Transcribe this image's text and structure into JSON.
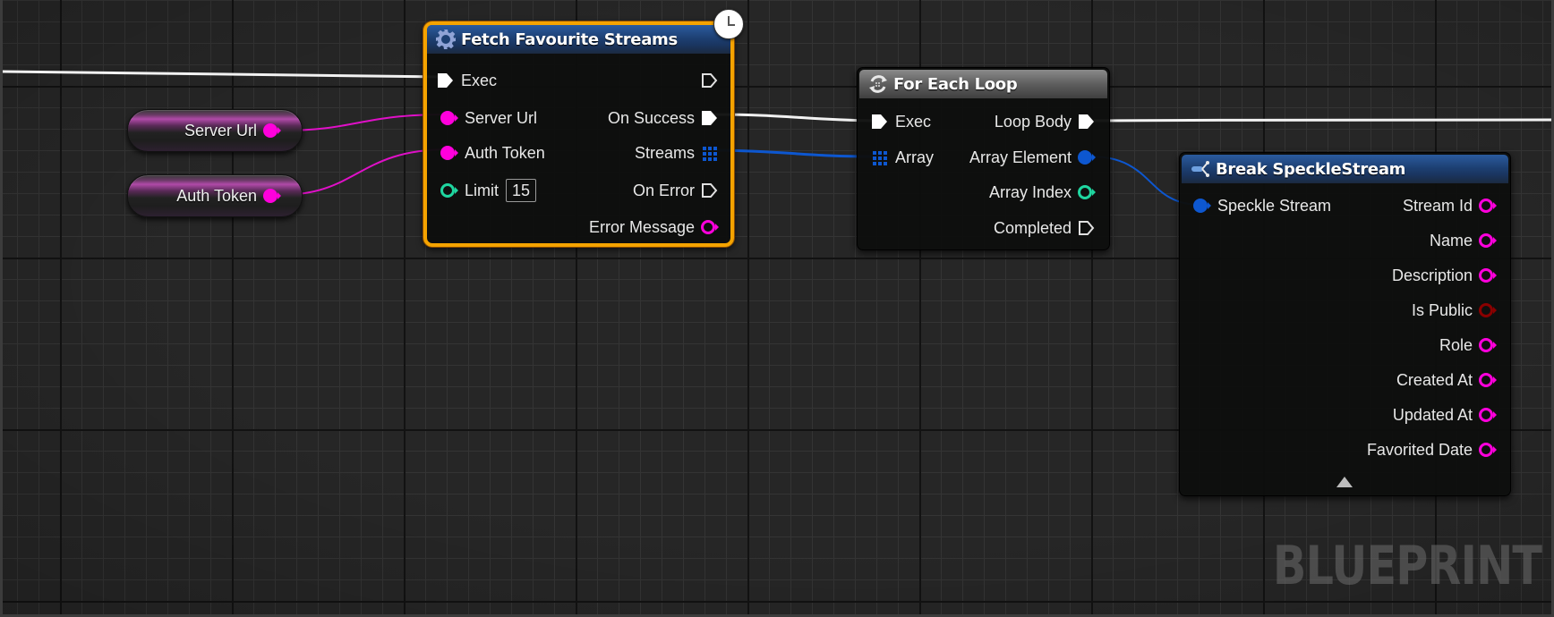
{
  "watermark": "BLUEPRINT",
  "colors": {
    "exec": "#ffffff",
    "string_pin": "#ff00dc",
    "struct_pin": "#0a5ed6",
    "int_pin": "#1fd6a0",
    "bool_pin": "#8a0000",
    "selected_border": "#f5a300"
  },
  "variables": [
    {
      "label": "Server Url",
      "type": "string"
    },
    {
      "label": "Auth Token",
      "type": "string"
    }
  ],
  "fetch_node": {
    "title": "Fetch Favourite Streams",
    "icon": "gear-icon",
    "badge": "clock-icon",
    "inputs": [
      {
        "label": "Exec",
        "type": "exec"
      },
      {
        "label": "Server Url",
        "type": "string"
      },
      {
        "label": "Auth Token",
        "type": "string"
      },
      {
        "label": "Limit",
        "type": "int",
        "value": "15"
      }
    ],
    "outputs": [
      {
        "label": "",
        "type": "exec"
      },
      {
        "label": "On Success",
        "type": "exec"
      },
      {
        "label": "Streams",
        "type": "array"
      },
      {
        "label": "On Error",
        "type": "exec"
      },
      {
        "label": "Error Message",
        "type": "string"
      }
    ]
  },
  "foreach_node": {
    "title": "For Each Loop",
    "icon": "loop-icon",
    "inputs": [
      {
        "label": "Exec",
        "type": "exec"
      },
      {
        "label": "Array",
        "type": "array"
      }
    ],
    "outputs": [
      {
        "label": "Loop Body",
        "type": "exec"
      },
      {
        "label": "Array Element",
        "type": "struct"
      },
      {
        "label": "Array Index",
        "type": "int"
      },
      {
        "label": "Completed",
        "type": "exec"
      }
    ]
  },
  "break_node": {
    "title": "Break SpeckleStream",
    "icon": "break-struct-icon",
    "inputs": [
      {
        "label": "Speckle Stream",
        "type": "struct"
      }
    ],
    "outputs": [
      {
        "label": "Stream Id",
        "type": "string"
      },
      {
        "label": "Name",
        "type": "string"
      },
      {
        "label": "Description",
        "type": "string"
      },
      {
        "label": "Is Public",
        "type": "bool"
      },
      {
        "label": "Role",
        "type": "string"
      },
      {
        "label": "Created At",
        "type": "string"
      },
      {
        "label": "Updated At",
        "type": "string"
      },
      {
        "label": "Favorited Date",
        "type": "string"
      }
    ]
  }
}
